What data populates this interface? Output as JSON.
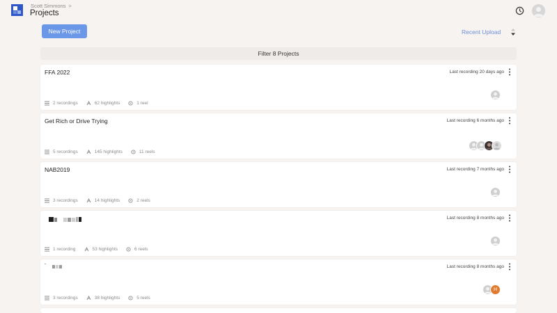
{
  "header": {
    "breadcrumb": "Scott Simmons",
    "breadcrumb_sep": ">",
    "title": "Projects"
  },
  "toolbar": {
    "new_project_label": "New Project",
    "sort_label": "Recent Upload"
  },
  "filter": {
    "label": "Filter 8 Projects"
  },
  "projects": [
    {
      "title": "FFA 2022",
      "last_recording": "Last recording 20 days ago",
      "recordings": "2 recordings",
      "highlights": "62 highlights",
      "reels": "1 reel"
    },
    {
      "title": "Get Rich or Drive Trying",
      "last_recording": "Last recording 6 months ago",
      "recordings": "5 recordings",
      "highlights": "145 highlights",
      "reels": "11 reels"
    },
    {
      "title": "NAB2019",
      "last_recording": "Last recording 7 months ago",
      "recordings": "3 recordings",
      "highlights": "14 highlights",
      "reels": "2 reels"
    },
    {
      "title": "",
      "last_recording": "Last recording 8 months ago",
      "recordings": "1 recording",
      "highlights": "53 highlights",
      "reels": "6 reels"
    },
    {
      "title": "",
      "last_recording": "Last recording 8 months ago",
      "recordings": "3 recordings",
      "highlights": "38 highlights",
      "reels": "5 reels",
      "avatar_initial": "H"
    }
  ],
  "colors": {
    "background": "#f6f3f1",
    "accent": "#6b97e8",
    "link": "#6b8fd6",
    "avatar_orange": "#e07a2e"
  },
  "icons": [
    "logo-icon",
    "clock-icon",
    "user-avatar",
    "sort-arrows-icon",
    "kebab-icon",
    "recordings-icon",
    "highlights-icon",
    "reels-icon"
  ]
}
